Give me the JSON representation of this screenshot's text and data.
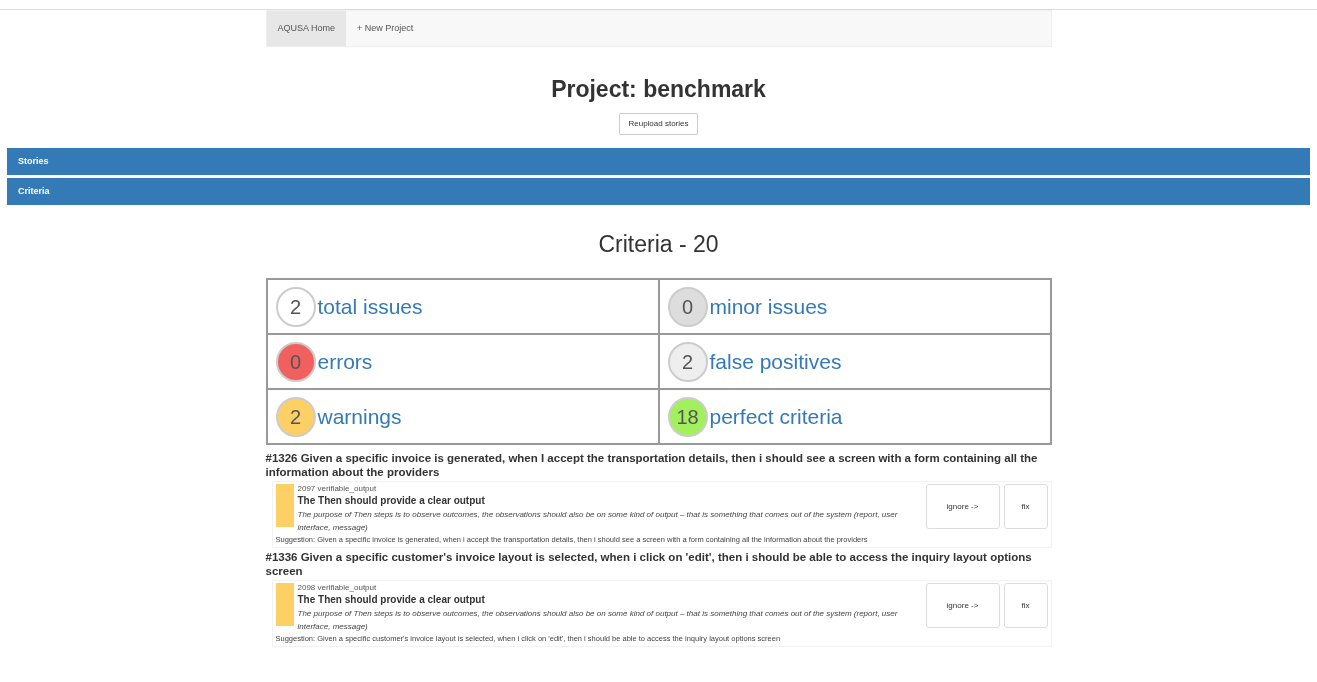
{
  "nav": [
    {
      "label": "AQUSA Home",
      "selected": true
    },
    {
      "label": "+ New Project",
      "selected": false
    }
  ],
  "title": "Project: benchmark",
  "reupload_button": "Reupload stories",
  "panels": [
    {
      "label": "Stories"
    },
    {
      "label": "Criteria"
    }
  ],
  "criteria_title": "Criteria - 20",
  "stats": [
    {
      "count": "2",
      "label": "total issues",
      "color": "#ffffff"
    },
    {
      "count": "0",
      "label": "minor issues",
      "color": "#dddddd"
    },
    {
      "count": "0",
      "label": "errors",
      "color": "#f0605f"
    },
    {
      "count": "2",
      "label": "false positives",
      "color": "#eeeeee"
    },
    {
      "count": "2",
      "label": "warnings",
      "color": "#fcd065"
    },
    {
      "count": "18",
      "label": "perfect criteria",
      "color": "#a3f05f"
    }
  ],
  "issues": [
    {
      "story": "#1326 Given a specific invoice is generated, when I accept the transportation details, then i should see a screen with a form containing all the information about the providers",
      "code": "2097 verifiable_output",
      "color": "#fcd065",
      "heading": "The Then should provide a clear output",
      "description": "The purpose of Then steps is to observe outcomes, the observations should also be on some kind of output – that is something that comes out of the system (report, user interface, message)",
      "suggestion": "Suggestion: Given a specific invoice is generated, when i accept the transportation details, then i should see a screen with a form containing all the information about the providers",
      "ignore": "ignore ->",
      "fix": "fix"
    },
    {
      "story": "#1336 Given a specific customer's invoice layout is selected, when i click on 'edit', then i should be able to access the inquiry layout options screen",
      "code": "2098 verifiable_output",
      "color": "#fcd065",
      "heading": "The Then should provide a clear output",
      "description": "The purpose of Then steps is to observe outcomes, the observations should also be on some kind of output – that is something that comes out of the system (report, user interface, message)",
      "suggestion": "Suggestion: Given a specific customer's invoice layout is selected, when i click on 'edit', then i should be able to access the inquiry layout options screen",
      "ignore": "ignore ->",
      "fix": "fix"
    }
  ]
}
